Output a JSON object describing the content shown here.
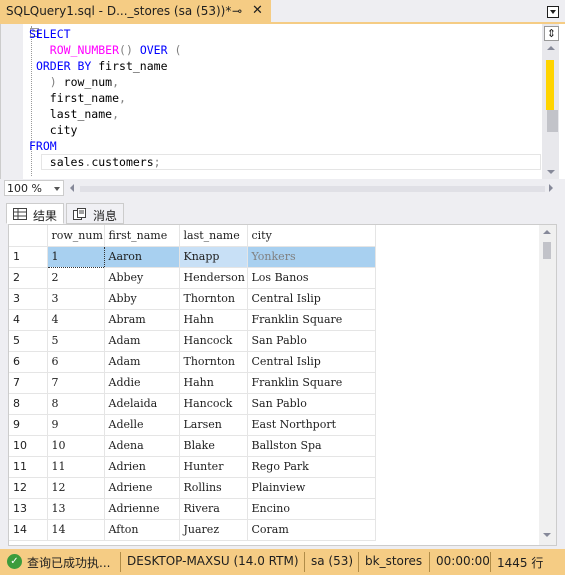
{
  "tab": {
    "title": "SQLQuery1.sql - D..._stores (sa (53))*",
    "pin_icon": "pin-icon",
    "close_glyph": "✕"
  },
  "editor": {
    "lines": [
      [
        {
          "t": "SELECT",
          "c": "kw"
        }
      ],
      [
        {
          "t": "   "
        },
        {
          "t": "ROW_NUMBER",
          "c": "fn"
        },
        {
          "t": "()",
          "c": "gray"
        },
        {
          "t": " "
        },
        {
          "t": "OVER",
          "c": "kw"
        },
        {
          "t": " (",
          "c": "gray"
        }
      ],
      [
        {
          "t": " "
        },
        {
          "t": "ORDER BY",
          "c": "kw"
        },
        {
          "t": " first_name"
        }
      ],
      [
        {
          "t": "   "
        },
        {
          "t": ")",
          "c": "gray"
        },
        {
          "t": " row_num"
        },
        {
          "t": ",",
          "c": "gray"
        }
      ],
      [
        {
          "t": "   first_name"
        },
        {
          "t": ",",
          "c": "gray"
        }
      ],
      [
        {
          "t": "   last_name"
        },
        {
          "t": ",",
          "c": "gray"
        }
      ],
      [
        {
          "t": "   city"
        }
      ],
      [
        {
          "t": "FROM",
          "c": "kw"
        }
      ],
      [
        {
          "t": "   sales"
        },
        {
          "t": ".",
          "c": "gray"
        },
        {
          "t": "customers"
        },
        {
          "t": ";",
          "c": "gray"
        }
      ]
    ]
  },
  "zoom": {
    "value": "100 %"
  },
  "results_tabs": [
    {
      "label": "结果",
      "icon": "grid-icon"
    },
    {
      "label": "消息",
      "icon": "messages-icon"
    }
  ],
  "grid": {
    "columns": [
      "row_num",
      "first_name",
      "last_name",
      "city"
    ],
    "rows": [
      [
        "1",
        "1",
        "Aaron",
        "Knapp",
        "Yonkers"
      ],
      [
        "2",
        "2",
        "Abbey",
        "Henderson",
        "Los Banos"
      ],
      [
        "3",
        "3",
        "Abby",
        "Thornton",
        "Central Islip"
      ],
      [
        "4",
        "4",
        "Abram",
        "Hahn",
        "Franklin Square"
      ],
      [
        "5",
        "5",
        "Adam",
        "Hancock",
        "San Pablo"
      ],
      [
        "6",
        "6",
        "Adam",
        "Thornton",
        "Central Islip"
      ],
      [
        "7",
        "7",
        "Addie",
        "Hahn",
        "Franklin Square"
      ],
      [
        "8",
        "8",
        "Adelaida",
        "Hancock",
        "San Pablo"
      ],
      [
        "9",
        "9",
        "Adelle",
        "Larsen",
        "East Northport"
      ],
      [
        "10",
        "10",
        "Adena",
        "Blake",
        "Ballston Spa"
      ],
      [
        "11",
        "11",
        "Adrien",
        "Hunter",
        "Rego Park"
      ],
      [
        "12",
        "12",
        "Adriene",
        "Rollins",
        "Plainview"
      ],
      [
        "13",
        "13",
        "Adrienne",
        "Rivera",
        "Encino"
      ],
      [
        "14",
        "14",
        "Afton",
        "Juarez",
        "Coram"
      ]
    ]
  },
  "status": {
    "message": "查询已成功执...",
    "server": "DESKTOP-MAXSU (14.0 RTM)",
    "login": "sa (53)",
    "database": "bk_stores",
    "elapsed": "00:00:00",
    "rows": "1445 行"
  },
  "colors": {
    "accent": "#f5cc84",
    "keyword": "#0000ff",
    "function": "#ff00ff",
    "selection": "#a8d0f0"
  }
}
